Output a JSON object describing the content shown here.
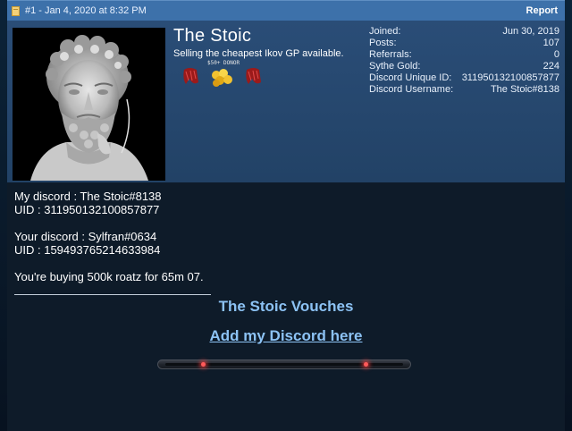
{
  "post": {
    "header": "#1 - Jan 4, 2020 at 8:32 PM",
    "report_label": "Report"
  },
  "user": {
    "username": "The Stoic",
    "title": "Selling the cheapest Ikov GP available.",
    "badge_text": "$50+ DONOR",
    "stats": [
      {
        "label": "Joined:",
        "value": "Jun 30, 2019"
      },
      {
        "label": "Posts:",
        "value": "107"
      },
      {
        "label": "Referrals:",
        "value": "0"
      },
      {
        "label": "Sythe Gold:",
        "value": "224"
      },
      {
        "label": "Discord Unique ID:",
        "value": "311950132100857877"
      },
      {
        "label": "Discord Username:",
        "value": "The Stoic#8138"
      }
    ]
  },
  "content": {
    "lines": [
      "My discord : The Stoic#8138",
      "UID : 311950132100857877",
      "",
      "Your discord : Sylfran#0634",
      "UID : 159493765214633984",
      "",
      "You're buying 500k roatz for 65m 07."
    ],
    "vouches_label": "The Stoic Vouches",
    "discord_link": "Add my Discord here"
  },
  "colors": {
    "header_bar": "#3d71aa",
    "user_panel": "#2a4d77",
    "content_bg": "#0e1b29",
    "link": "#8cc2f4"
  },
  "icons": [
    "post-icon",
    "claw-icon",
    "gold-coins-icon"
  ]
}
